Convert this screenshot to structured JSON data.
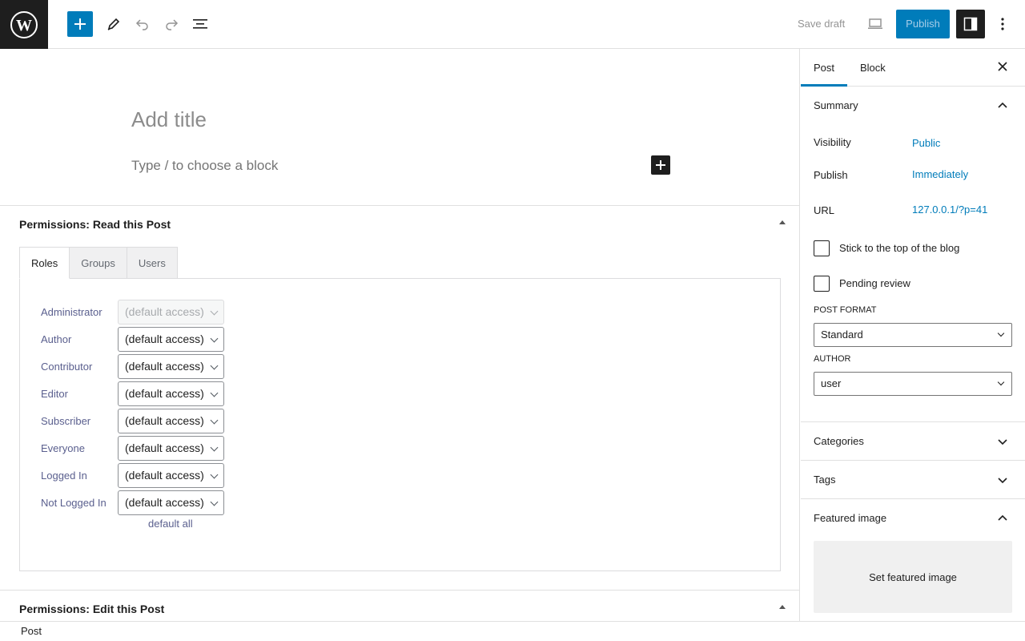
{
  "header": {
    "logo_icon": "wordpress-logo-icon",
    "toolbar_icons": [
      "plus-icon",
      "pencil-icon",
      "undo-icon",
      "redo-icon",
      "list-view-icon"
    ],
    "save_draft_label": "Save draft",
    "publish_label": "Publish",
    "colors": {
      "accent": "#007cba",
      "dark": "#1e1e1e"
    }
  },
  "editor": {
    "title_placeholder": "Add title",
    "block_placeholder": "Type / to choose a block"
  },
  "metabox_read": {
    "title": "Permissions: Read this Post",
    "tabs": [
      "Roles",
      "Groups",
      "Users"
    ],
    "active_tab": "Roles",
    "roles": [
      {
        "label": "Administrator",
        "value": "(default access)",
        "disabled": true
      },
      {
        "label": "Author",
        "value": "(default access)"
      },
      {
        "label": "Contributor",
        "value": "(default access)"
      },
      {
        "label": "Editor",
        "value": "(default access)"
      },
      {
        "label": "Subscriber",
        "value": "(default access)"
      },
      {
        "label": "Everyone",
        "value": "(default access)"
      },
      {
        "label": "Logged In",
        "value": "(default access)"
      },
      {
        "label": "Not Logged In",
        "value": "(default access)"
      }
    ],
    "default_all_link": "default all"
  },
  "metabox_edit": {
    "title": "Permissions: Edit this Post"
  },
  "footer": {
    "breadcrumb": "Post"
  },
  "sidebar": {
    "tabs": [
      "Post",
      "Block"
    ],
    "active_tab": "Post",
    "summary": {
      "title": "Summary",
      "visibility_label": "Visibility",
      "visibility_value": "Public",
      "publish_label": "Publish",
      "publish_value": "Immediately",
      "url_label": "URL",
      "url_value": "127.0.0.1/?p=41",
      "sticky_label": "Stick to the top of the blog",
      "pending_label": "Pending review",
      "post_format_label": "POST FORMAT",
      "post_format_value": "Standard",
      "author_label": "AUTHOR",
      "author_value": "user"
    },
    "categories_title": "Categories",
    "tags_title": "Tags",
    "featured_image_title": "Featured image",
    "featured_image_button": "Set featured image"
  }
}
